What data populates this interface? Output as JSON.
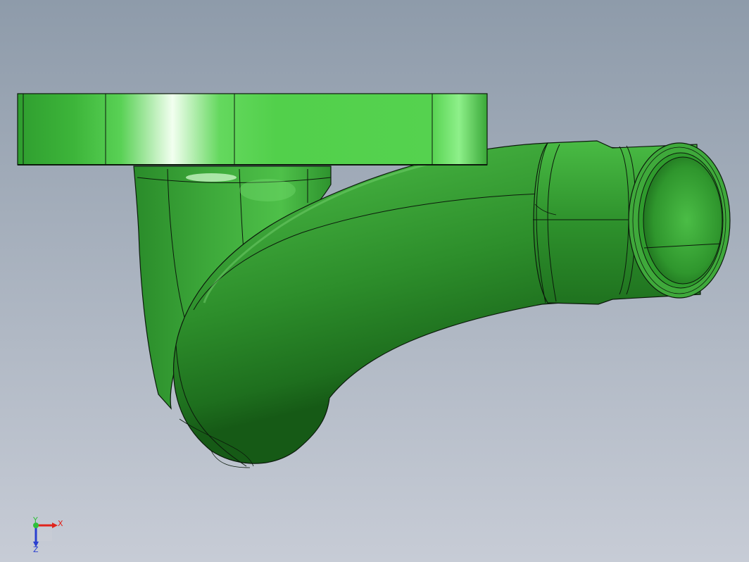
{
  "viewport": {
    "background_top": "#8e9baa",
    "background_bottom": "#c7ccd6",
    "part_color": "#3fb23a",
    "edge_color": "#0b1a0b"
  },
  "triad": {
    "x_label": "X",
    "y_label": "Y",
    "z_label": "Z",
    "x_color": "#e0231c",
    "y_color": "#2fbf3a",
    "z_color": "#2a3fd0"
  }
}
